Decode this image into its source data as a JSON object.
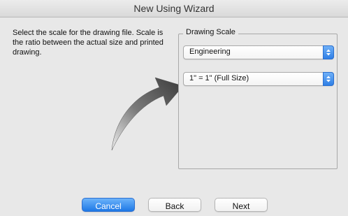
{
  "window": {
    "title": "New Using Wizard"
  },
  "instructions": "Select the scale for the drawing file.  Scale is the ratio between the actual size and printed drawing.",
  "group": {
    "label": "Drawing Scale",
    "unit_select": {
      "value": "Engineering"
    },
    "scale_select": {
      "value": "1\" = 1\" (Full Size)"
    }
  },
  "buttons": {
    "cancel": "Cancel",
    "back": "Back",
    "next": "Next"
  },
  "colors": {
    "accent": "#2f7fe6",
    "background": "#e8e8e8"
  }
}
